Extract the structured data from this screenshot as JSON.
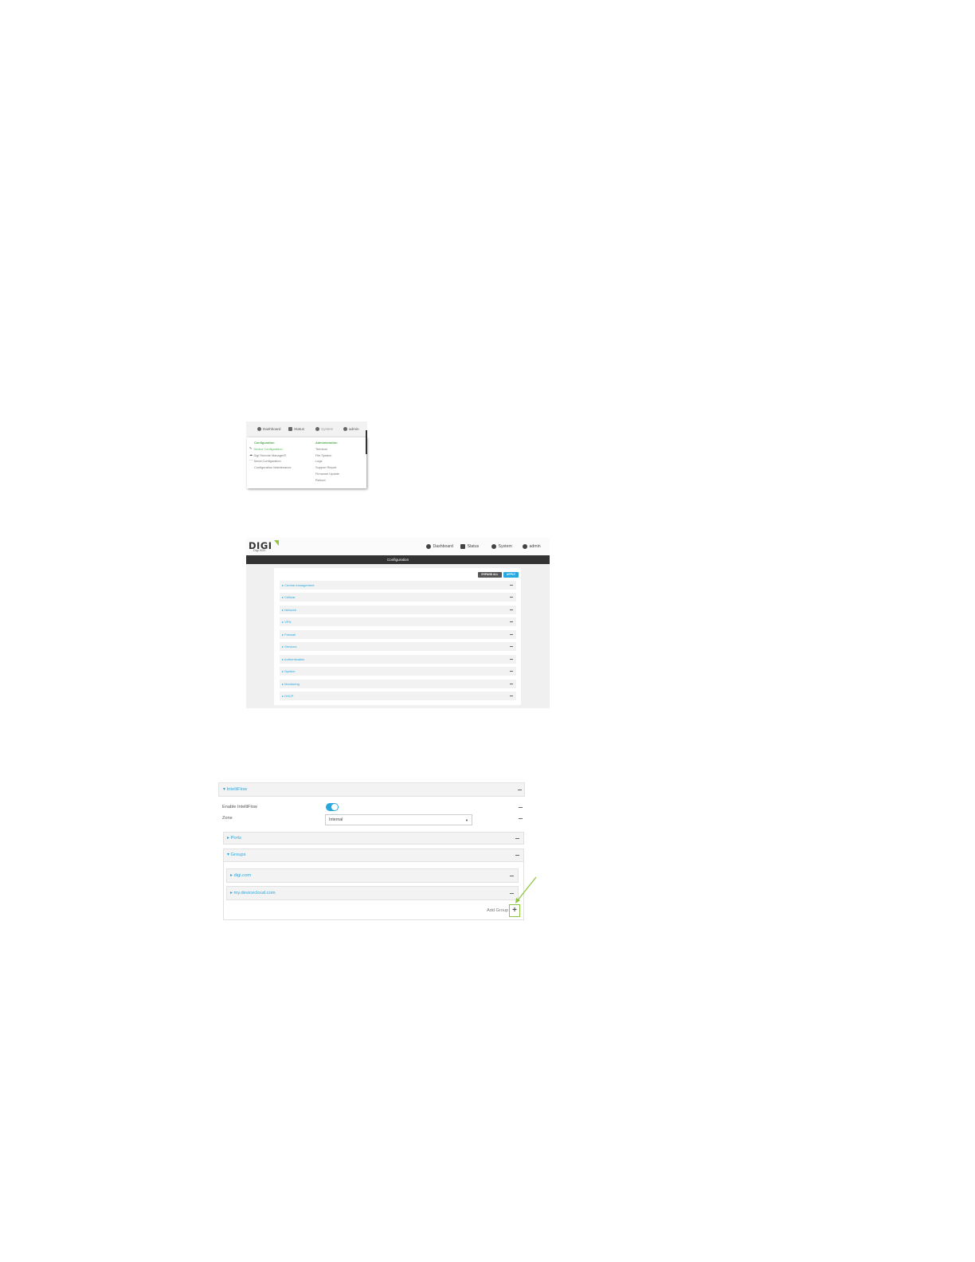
{
  "shot1": {
    "nav": {
      "dashboard": "Dashboard",
      "status": "Status",
      "system": "System",
      "admin": "admin"
    },
    "configuration": {
      "heading": "Configuration",
      "items": [
        "Device Configuration",
        "Digi Remote Manager®",
        "Serial Configuration",
        "Configuration Maintenance"
      ]
    },
    "administration": {
      "heading": "Administration",
      "items": [
        "Terminal",
        "File System",
        "Logs",
        "Support Report",
        "Firmware Update",
        "Reboot"
      ]
    }
  },
  "shot2": {
    "logo": "DIGI",
    "logo_sub": "Digi IX20",
    "nav": {
      "dashboard": "Dashboard",
      "status": "Status",
      "system": "System",
      "admin": "admin"
    },
    "page_title": "Configuration",
    "expand_all": "EXPAND ALL",
    "apply": "APPLY",
    "sections": [
      "Central management",
      "Cellular",
      "Network",
      "VPN",
      "Firewall",
      "Services",
      "Authentication",
      "System",
      "Monitoring",
      "DHCP"
    ]
  },
  "shot3": {
    "header": "IntelliFlow",
    "enable_label": "Enable IntelliFlow",
    "zone_label": "Zone",
    "zone_value": "Internal",
    "ports": "Ports",
    "groups": "Groups",
    "group_items": [
      "digi.com",
      "my.devicecloud.com"
    ],
    "add_group": "Add Group"
  },
  "colors": {
    "accent_blue": "#29a8e0",
    "accent_green": "#8dc63f",
    "title_bar": "#333333"
  }
}
